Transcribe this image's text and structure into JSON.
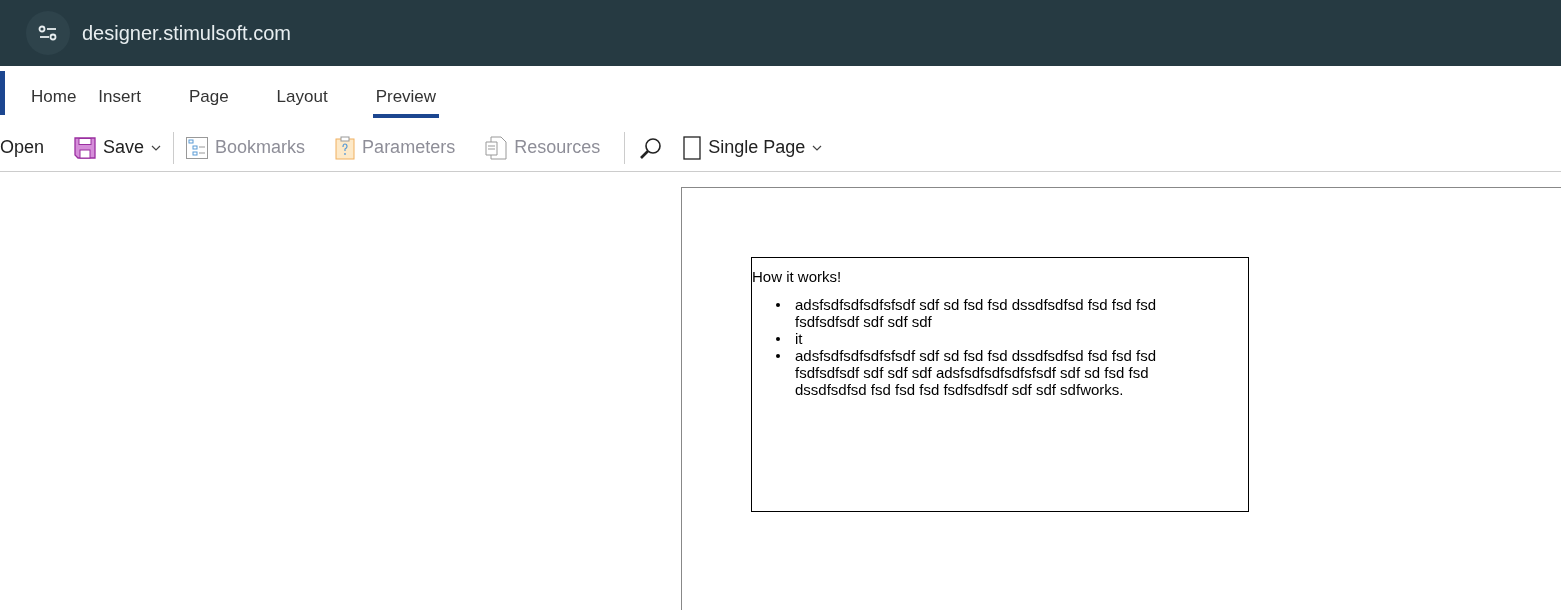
{
  "browser": {
    "url": "designer.stimulsoft.com"
  },
  "tabs": [
    {
      "label": "Home",
      "selected": false
    },
    {
      "label": "Insert",
      "selected": false
    },
    {
      "label": "Page",
      "selected": false
    },
    {
      "label": "Layout",
      "selected": false
    },
    {
      "label": "Preview",
      "selected": true
    }
  ],
  "toolbar": [
    {
      "kind": "text",
      "label": "Open",
      "disabled": false
    },
    {
      "kind": "save",
      "label": "Save",
      "disabled": false,
      "dropdown": true
    },
    {
      "kind": "separator"
    },
    {
      "kind": "bookmarks",
      "label": "Bookmarks",
      "disabled": true,
      "dropdown": false
    },
    {
      "kind": "parameters",
      "label": "Parameters",
      "disabled": true,
      "dropdown": false
    },
    {
      "kind": "resources",
      "label": "Resources",
      "disabled": true,
      "dropdown": false
    },
    {
      "kind": "separator"
    },
    {
      "kind": "search"
    },
    {
      "kind": "page",
      "label": "Single Page",
      "disabled": false,
      "dropdown": true
    }
  ],
  "report": {
    "heading": "How it works!",
    "items": [
      "adsfsdfsdfsdfsfsdf sdf sd fsd fsd dssdfsdfsd fsd fsd fsd fsdfsdfsdf sdf sdf sdf",
      "it",
      "adsfsdfsdfsdfsfsdf sdf sd fsd fsd dssdfsdfsd fsd fsd fsd fsdfsdfsdf sdf sdf sdf adsfsdfsdfsdfsfsdf sdf sd fsd fsd dssdfsdfsd fsd fsd fsd fsdfsdfsdf sdf sdf sdfworks."
    ]
  }
}
